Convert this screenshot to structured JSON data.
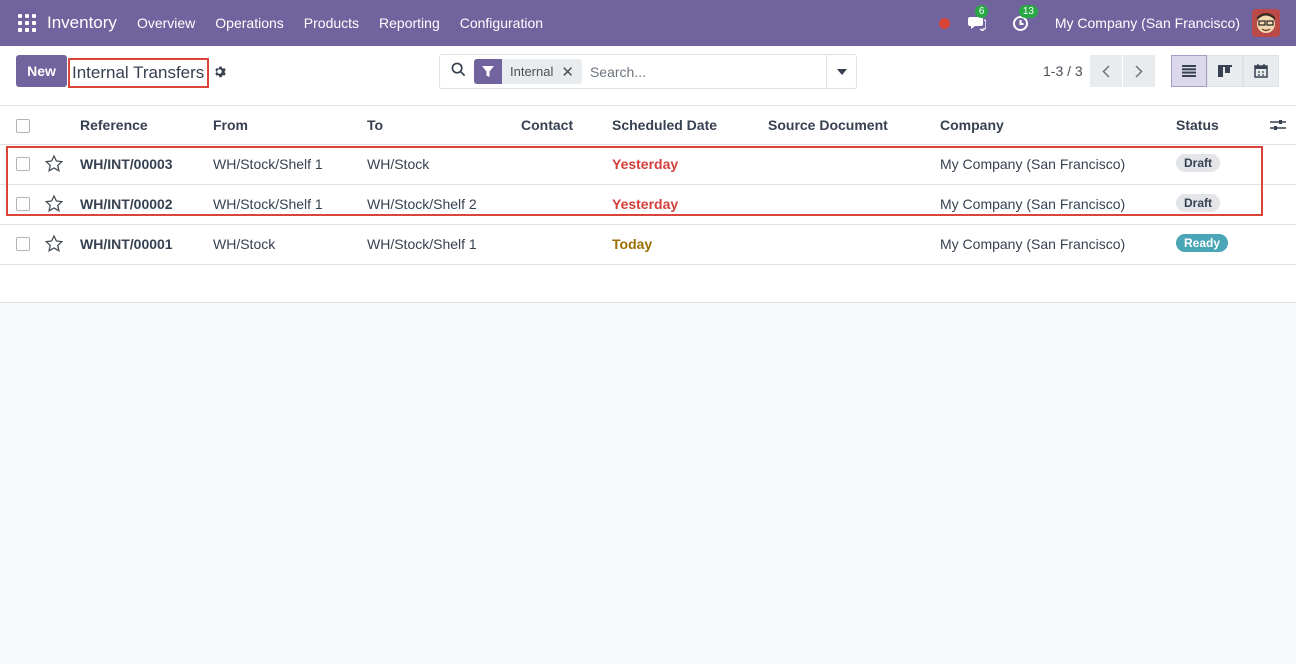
{
  "navbar": {
    "app_name": "Inventory",
    "menu": [
      "Overview",
      "Operations",
      "Products",
      "Reporting",
      "Configuration"
    ],
    "messages_count": "6",
    "activities_count": "13",
    "company": "My Company (San Francisco)"
  },
  "control": {
    "new_label": "New",
    "title": "Internal Transfers",
    "facet_label": "Internal",
    "search_placeholder": "Search...",
    "pager": "1-3 / 3"
  },
  "table": {
    "headers": {
      "reference": "Reference",
      "from": "From",
      "to": "To",
      "contact": "Contact",
      "scheduled_date": "Scheduled Date",
      "source_document": "Source Document",
      "company": "Company",
      "status": "Status"
    },
    "rows": [
      {
        "reference": "WH/INT/00003",
        "from": "WH/Stock/Shelf 1",
        "to": "WH/Stock",
        "contact": "",
        "scheduled_date": "Yesterday",
        "source_document": "",
        "company": "My Company (San Francisco)",
        "status": "Draft"
      },
      {
        "reference": "WH/INT/00002",
        "from": "WH/Stock/Shelf 1",
        "to": "WH/Stock/Shelf 2",
        "contact": "",
        "scheduled_date": "Yesterday",
        "source_document": "",
        "company": "My Company (San Francisco)",
        "status": "Draft"
      },
      {
        "reference": "WH/INT/00001",
        "from": "WH/Stock",
        "to": "WH/Stock/Shelf 1",
        "contact": "",
        "scheduled_date": "Today",
        "source_document": "",
        "company": "My Company (San Francisco)",
        "status": "Ready"
      }
    ]
  },
  "colors": {
    "brand": "#71639e",
    "late": "#d23f3a",
    "today": "#9a6f00",
    "ready": "#4aa5b6",
    "annotation": "#d9453b"
  }
}
